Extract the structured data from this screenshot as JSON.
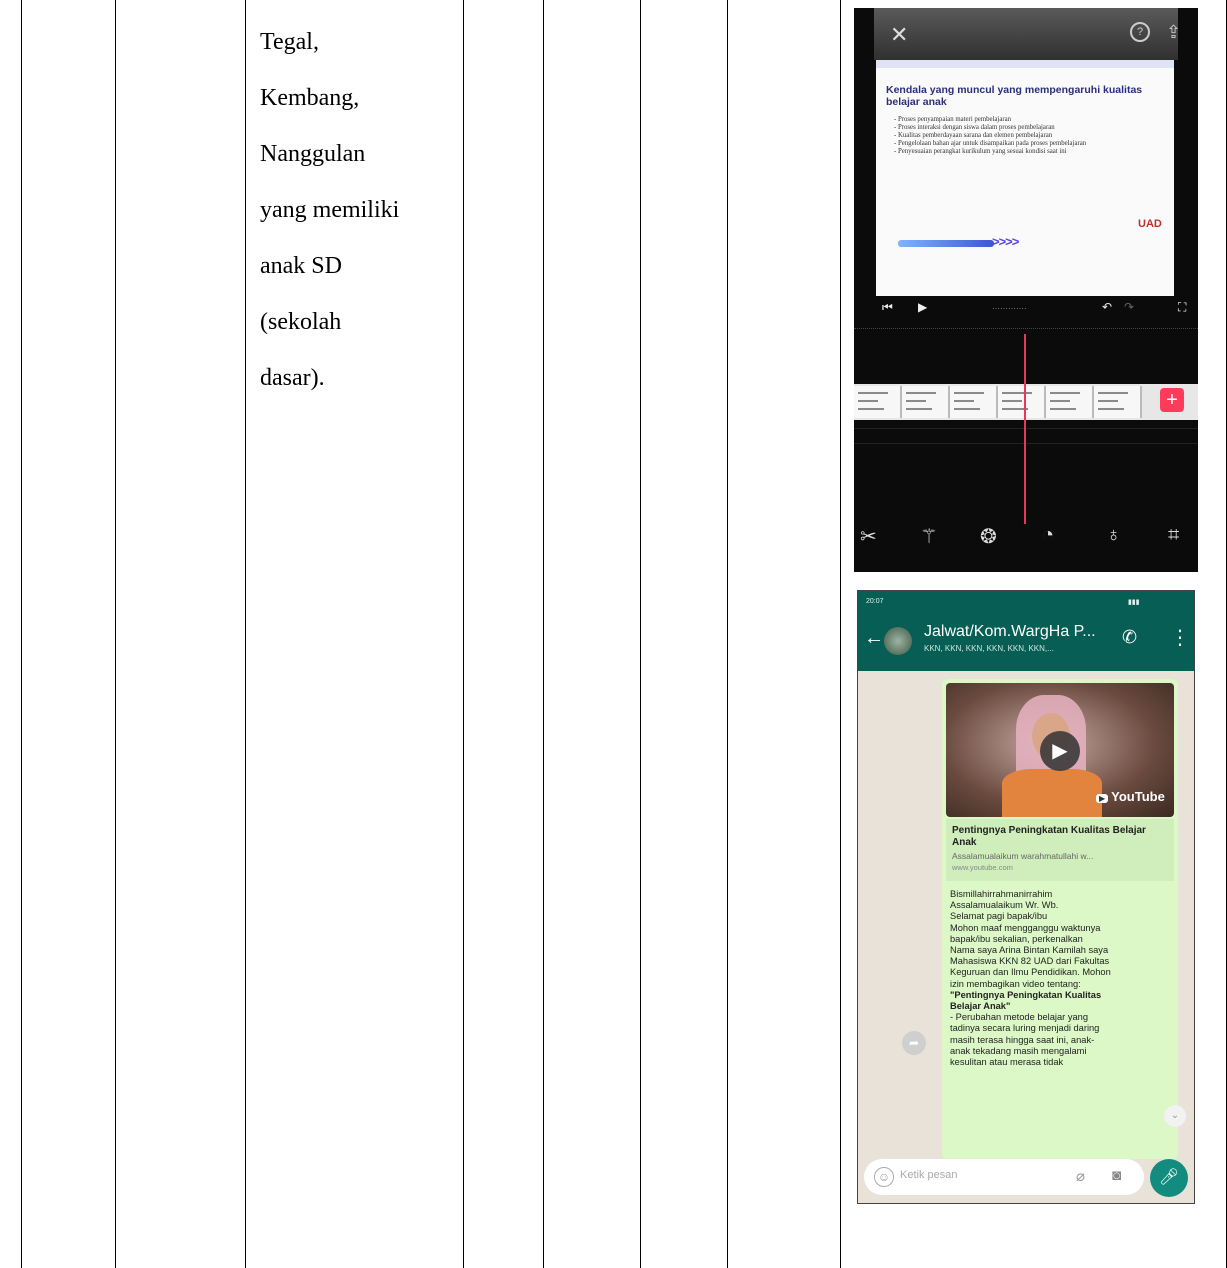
{
  "table": {
    "cell_text_lines": [
      "Tegal,",
      "Kembang,",
      "Nanggulan",
      "yang memiliki",
      "anak SD",
      "(sekolah",
      "dasar)."
    ]
  },
  "editor_screenshot": {
    "close_icon": "close-icon",
    "slide_title": "Kendala yang muncul yang mempengaruhi kualitas belajar anak",
    "slide_bullets": [
      "Proses penyampaian materi pembelajaran",
      "Proses interaksi dengan siswa dalam proses pembelajaran",
      "Kualitas pemberdayaan sarana dan elemen pembelajaran",
      "Pengelolaan bahan ajar untuk disampaikan pada proses pembelajaran",
      "Penyesuaian perangkat kurikulum yang sesuai kondisi saat ini"
    ],
    "slide_arrows": ">>>>",
    "logo_text": "UAD",
    "accent_color": "#e8365d"
  },
  "chat_screenshot": {
    "status_time": "20:07",
    "group_name": "Jalwat/Kom.WargHa P...",
    "group_members": "KKN, KKN, KKN, KKN, KKN, KKN,...",
    "video_brand": "YouTube",
    "link_title": "Pentingnya Peningkatan Kualitas Belajar Anak",
    "link_desc": "Assalamualaikum warahmatullahi w...",
    "link_url": "www.youtube.com",
    "message_lines": [
      "Bismillahirrahmanirrahim",
      "Assalamualaikum Wr. Wb.",
      "Selamat pagi bapak/ibu",
      "Mohon maaf mengganggu waktunya",
      "bapak/ibu sekalian, perkenalkan",
      "Nama saya Arina Bintan Kamilah saya",
      "Mahasiswa KKN 82 UAD dari Fakultas",
      "Keguruan dan Ilmu Pendidikan. Mohon",
      "izin membagikan video tentang:",
      "\"Pentingnya Peningkatan Kualitas",
      "Belajar Anak\"",
      "- Perubahan metode belajar yang",
      "tadinya secara luring menjadi daring",
      "masih terasa hingga saat ini, anak-",
      "anak tekadang masih mengalami",
      "kesulitan atau merasa tidak"
    ],
    "input_placeholder": "Ketik pesan",
    "header_color": "#075e54",
    "mic_color": "#128c7e"
  }
}
